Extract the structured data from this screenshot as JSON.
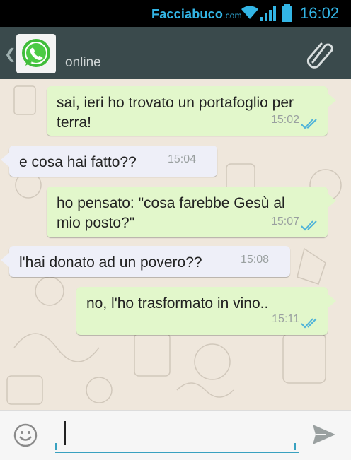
{
  "statusbar": {
    "brand": "Facciabuco",
    "brand_suffix": ".com",
    "time": "16:02",
    "icons": [
      "wifi-icon",
      "signal-icon",
      "battery-icon"
    ]
  },
  "header": {
    "back_icon": "chevron-left-icon",
    "avatar_icon": "whatsapp-logo-icon",
    "status": "online",
    "attach_icon": "paperclip-icon"
  },
  "messages": [
    {
      "direction": "out",
      "text_line1": "sai, ieri ho trovato un portafoglio per",
      "text_line2": "terra!",
      "time": "15:02",
      "read": true
    },
    {
      "direction": "in",
      "text": "e cosa hai fatto??",
      "time": "15:04"
    },
    {
      "direction": "out",
      "text_line1": "ho pensato: \"cosa farebbe Gesù al",
      "text_line2": "mio posto?\"",
      "time": "15:07",
      "read": true
    },
    {
      "direction": "in",
      "text": "l'hai donato ad un povero??",
      "time": "15:08"
    },
    {
      "direction": "out",
      "text": "no, l'ho trasformato in vino..",
      "time": "15:11",
      "read": true
    }
  ],
  "composer": {
    "emoji_icon": "smiley-icon",
    "input_value": "",
    "placeholder": "",
    "send_icon": "send-icon"
  },
  "colors": {
    "statusbar_text": "#33b5e5",
    "actionbar_bg": "#3a4a4c",
    "chat_bg": "#efe7dc",
    "outgoing_bubble": "#e2f7cb",
    "incoming_bubble": "#eeeff8",
    "read_ticks": "#4fb3d9",
    "input_underline": "#39a1c0"
  }
}
